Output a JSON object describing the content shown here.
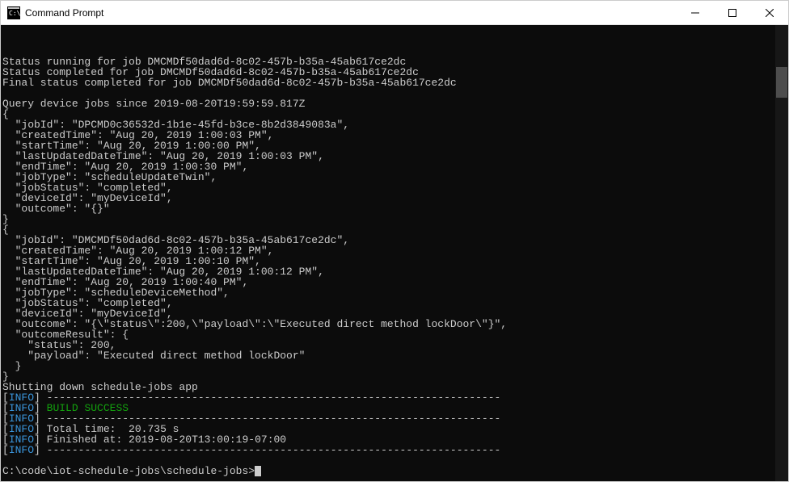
{
  "window": {
    "title": "Command Prompt"
  },
  "terminal": {
    "lines": {
      "l1": "Status running for job DMCMDf50dad6d-8c02-457b-b35a-45ab617ce2dc",
      "l2": "Status completed for job DMCMDf50dad6d-8c02-457b-b35a-45ab617ce2dc",
      "l3": "Final status completed for job DMCMDf50dad6d-8c02-457b-b35a-45ab617ce2dc",
      "l4": "",
      "l5": "Query device jobs since 2019-08-20T19:59:59.817Z",
      "l6": "{",
      "l7": "  \"jobId\": \"DPCMD0c36532d-1b1e-45fd-b3ce-8b2d3849083a\",",
      "l8": "  \"createdTime\": \"Aug 20, 2019 1:00:03 PM\",",
      "l9": "  \"startTime\": \"Aug 20, 2019 1:00:00 PM\",",
      "l10": "  \"lastUpdatedDateTime\": \"Aug 20, 2019 1:00:03 PM\",",
      "l11": "  \"endTime\": \"Aug 20, 2019 1:00:30 PM\",",
      "l12": "  \"jobType\": \"scheduleUpdateTwin\",",
      "l13": "  \"jobStatus\": \"completed\",",
      "l14": "  \"deviceId\": \"myDeviceId\",",
      "l15": "  \"outcome\": \"{}\"",
      "l16": "}",
      "l17": "{",
      "l18": "  \"jobId\": \"DMCMDf50dad6d-8c02-457b-b35a-45ab617ce2dc\",",
      "l19": "  \"createdTime\": \"Aug 20, 2019 1:00:12 PM\",",
      "l20": "  \"startTime\": \"Aug 20, 2019 1:00:10 PM\",",
      "l21": "  \"lastUpdatedDateTime\": \"Aug 20, 2019 1:00:12 PM\",",
      "l22": "  \"endTime\": \"Aug 20, 2019 1:00:40 PM\",",
      "l23": "  \"jobType\": \"scheduleDeviceMethod\",",
      "l24": "  \"jobStatus\": \"completed\",",
      "l25": "  \"deviceId\": \"myDeviceId\",",
      "l26": "  \"outcome\": \"{\\\"status\\\":200,\\\"payload\\\":\\\"Executed direct method lockDoor\\\"}\",",
      "l27": "  \"outcomeResult\": {",
      "l28": "    \"status\": 200,",
      "l29": "    \"payload\": \"Executed direct method lockDoor\"",
      "l30": "  }",
      "l31": "}",
      "l32": "Shutting down schedule-jobs app",
      "info_bracket_open": "[",
      "info_label": "INFO",
      "info_bracket_close": "]",
      "dash_line": " ------------------------------------------------------------------------",
      "build_success": " BUILD SUCCESS",
      "total_time": " Total time:  20.735 s",
      "finished_at": " Finished at: 2019-08-20T13:00:19-07:00",
      "prompt": "C:\\code\\iot-schedule-jobs\\schedule-jobs>"
    }
  }
}
